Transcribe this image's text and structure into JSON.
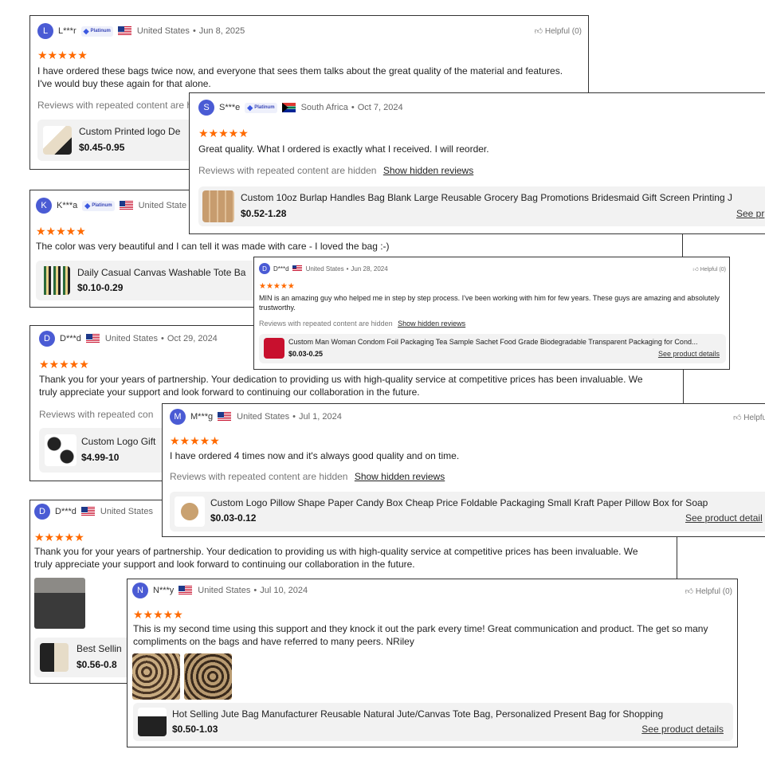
{
  "common": {
    "hidden_text": "Reviews with repeated content are hidden",
    "show_hidden": "Show hidden reviews",
    "see_details": "See product details",
    "helpful": "Helpful (0)",
    "badge": "Platinum",
    "stars": "★★★★★",
    "dot": "•",
    "rating": 5,
    "colors": {
      "star": "#ff6a00",
      "avatar": "#4a5bd4"
    }
  },
  "reviews": [
    {
      "initial": "L",
      "name": "L***r",
      "country": "United States",
      "date": "Jun 8, 2025",
      "text": "I have ordered these bags twice now, and everyone that sees them talks about the great quality of the material and features. I've would buy these again for that alone.",
      "product_title": "Custom Printed logo De",
      "price": "$0.45-0.95"
    },
    {
      "initial": "S",
      "name": "S***e",
      "country": "South Africa",
      "date": "Oct 7, 2024",
      "text": "Great quality. What I ordered is exactly what I received. I will reorder.",
      "product_title": "Custom 10oz Burlap Handles Bag Blank Large Reusable Grocery Bag Promotions Bridesmaid Gift Screen Printing J",
      "price": "$0.52-1.28",
      "see_partial": "See pr"
    },
    {
      "initial": "K",
      "name": "K***a",
      "country": "United State",
      "text": "The color was very beautiful and I can tell it was made with care - I loved the bag :-)",
      "product_title": "Daily Casual Canvas Washable Tote Ba",
      "price": "$0.10-0.29"
    },
    {
      "initial": "D",
      "name": "D***d",
      "country": "United States",
      "date": "Jun 28, 2024",
      "text": "MIN is an amazing guy who helped me in step by step process. I've been working with him for few years. These guys are amazing and absolutely trustworthy.",
      "product_title": "Custom Man Woman Condom Foil Packaging Tea Sample Sachet Food Grade Biodegradable Transparent Packaging for Cond...",
      "price": "$0.03-0.25"
    },
    {
      "initial": "D",
      "name": "D***d",
      "country": "United States",
      "date": "Oct 29, 2024",
      "text": "Thank you for your years of partnership. Your dedication to providing us with high-quality service at competitive prices has been invaluable. We truly appreciate your support and look forward to continuing our collaboration in the future.",
      "hidden_partial": "Reviews with repeated con",
      "product_title": "Custom Logo Gift",
      "price": "$4.99-10"
    },
    {
      "initial": "M",
      "name": "M***g",
      "country": "United States",
      "date": "Jul 1, 2024",
      "helpful_partial": "Helpfu",
      "text": "I have ordered 4 times now and it's always good quality and on time.",
      "product_title": "Custom Logo Pillow Shape Paper Candy Box Cheap Price Foldable Packaging Small Kraft Paper Pillow Box for Soap",
      "price": "$0.03-0.12",
      "see_partial": "See product detail"
    },
    {
      "initial": "D",
      "name": "D***d",
      "country": "United States",
      "text": "Thank you for your years of partnership. Your dedication to providing us with high-quality service at competitive prices has been invaluable. We truly appreciate your support and look forward to continuing our collaboration in the future.",
      "product_title": "Best Sellin",
      "price": "$0.56-0.8"
    },
    {
      "initial": "N",
      "name": "N***y",
      "country": "United States",
      "date": "Jul 10, 2024",
      "text": "This is my second time using this support and they knock it out the park every time! Great communication and product. The get so many compliments on the bags and have referred to many peers. NRiley",
      "product_title": "Hot Selling Jute Bag Manufacturer Reusable Natural Jute/Canvas Tote Bag, Personalized Present Bag for Shopping",
      "price": "$0.50-1.03"
    }
  ]
}
